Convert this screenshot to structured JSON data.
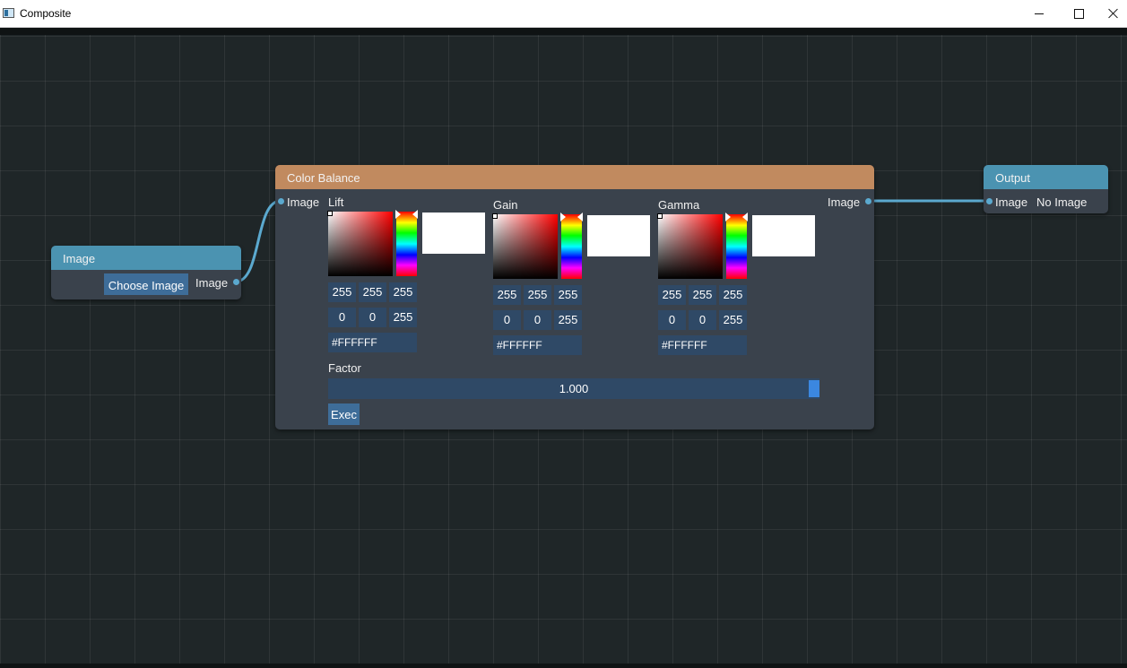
{
  "window": {
    "title": "Composite"
  },
  "colors": {
    "wire": "#5ba9cf",
    "image_header": "#4b93b1",
    "color_balance_header": "#c18a5f"
  },
  "image_node": {
    "title": "Image",
    "choose_button": "Choose Image",
    "output_port": "Image"
  },
  "color_balance_node": {
    "title": "Color Balance",
    "input_port": "Image",
    "output_port": "Image",
    "pickers": [
      {
        "label": "Lift",
        "rgb": [
          "255",
          "255",
          "255"
        ],
        "hsv": [
          "0",
          "0",
          "255"
        ],
        "hex": "#FFFFFF",
        "swatch": "#ffffff"
      },
      {
        "label": "Gain",
        "rgb": [
          "255",
          "255",
          "255"
        ],
        "hsv": [
          "0",
          "0",
          "255"
        ],
        "hex": "#FFFFFF",
        "swatch": "#ffffff"
      },
      {
        "label": "Gamma",
        "rgb": [
          "255",
          "255",
          "255"
        ],
        "hsv": [
          "0",
          "0",
          "255"
        ],
        "hex": "#FFFFFF",
        "swatch": "#ffffff"
      }
    ],
    "factor_label": "Factor",
    "factor_value": "1.000",
    "exec_button": "Exec"
  },
  "output_node": {
    "title": "Output",
    "input_port": "Image",
    "status": "No Image"
  }
}
